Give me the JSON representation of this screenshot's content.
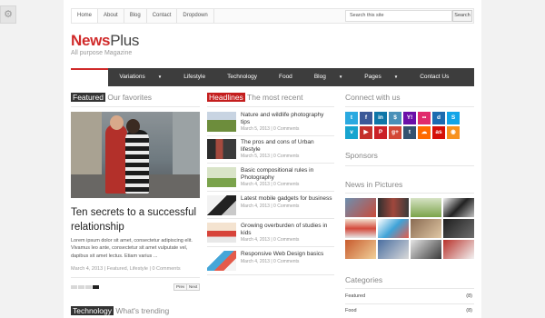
{
  "topbar": {
    "links": [
      "Home",
      "About",
      "Blog",
      "Contact",
      "Dropdown"
    ],
    "search_placeholder": "Search this site",
    "search_button": "Search"
  },
  "site": {
    "title_part1": "News",
    "title_part2": "Plus",
    "tagline": "All purpose Magazine"
  },
  "nav": {
    "items": [
      "Home",
      "Variations",
      "Lifestyle",
      "Technology",
      "Food",
      "Blog",
      "Pages",
      "Contact Us"
    ],
    "active": "Home"
  },
  "featured": {
    "label": "Featured",
    "subtitle": "Our favorites",
    "title": "Ten secrets to a successful relationship",
    "excerpt": "Lorem ipsum dolor sit amet, consectetur adipiscing elit. Vivamus leo ante, consectetur sit amet vulputate vel, dapibus sit amet lectus. Etiam varius ...",
    "meta": {
      "date": "March 4, 2013",
      "cat1": "Featured",
      "cat2": "Lifestyle",
      "comments": "0 Comments"
    },
    "prev": "Prev",
    "next": "Next"
  },
  "headlines": {
    "label": "Headlines",
    "subtitle": "The most recent",
    "items": [
      {
        "title": "Nature and wildlife photography tips",
        "date": "March 5, 2013",
        "comments": "0 Comments"
      },
      {
        "title": "The pros and cons of Urban lifestyle",
        "date": "March 5, 2013",
        "comments": "0 Comments"
      },
      {
        "title": "Basic compositional rules in Photography",
        "date": "March 4, 2013",
        "comments": "0 Comments"
      },
      {
        "title": "Latest mobile gadgets for business",
        "date": "March 4, 2013",
        "comments": "0 Comments"
      },
      {
        "title": "Growing overburden of studies in kids",
        "date": "March 4, 2013",
        "comments": "0 Comments"
      },
      {
        "title": "Responsive Web Design basics",
        "date": "March 4, 2013",
        "comments": "0 Comments"
      }
    ]
  },
  "technology": {
    "label": "Technology",
    "subtitle": "What's trending"
  },
  "sidebar": {
    "connect_title": "Connect with us",
    "socials": [
      {
        "name": "twitter-icon",
        "glyph": "t",
        "color": "#2aa9e0"
      },
      {
        "name": "facebook-icon",
        "glyph": "f",
        "color": "#3b5998"
      },
      {
        "name": "linkedin-icon",
        "glyph": "in",
        "color": "#0e76a8"
      },
      {
        "name": "dollar-icon",
        "glyph": "$",
        "color": "#4a90b8"
      },
      {
        "name": "yahoo-icon",
        "glyph": "Y!",
        "color": "#6b0fa8"
      },
      {
        "name": "flickr-icon",
        "glyph": "••",
        "color": "#e02a6c"
      },
      {
        "name": "digg-icon",
        "glyph": "d",
        "color": "#1d6bb0"
      },
      {
        "name": "skype-icon",
        "glyph": "S",
        "color": "#12a5e8"
      },
      {
        "name": "vimeo-icon",
        "glyph": "v",
        "color": "#17a4cf"
      },
      {
        "name": "youtube-icon",
        "glyph": "▶",
        "color": "#c4302b"
      },
      {
        "name": "pinterest-icon",
        "glyph": "P",
        "color": "#cb2027"
      },
      {
        "name": "googleplus-icon",
        "glyph": "g+",
        "color": "#d34836"
      },
      {
        "name": "tumblr-icon",
        "glyph": "t",
        "color": "#34526f"
      },
      {
        "name": "soundcloud-icon",
        "glyph": "☁",
        "color": "#ff6a00"
      },
      {
        "name": "lastfm-icon",
        "glyph": "as",
        "color": "#d51007"
      },
      {
        "name": "rss-icon",
        "glyph": "◉",
        "color": "#f7921e"
      }
    ],
    "sponsors_title": "Sponsors",
    "nip_title": "News in Pictures",
    "categories_title": "Categories",
    "categories": [
      {
        "name": "Featured",
        "count": "(8)"
      },
      {
        "name": "Food",
        "count": "(8)"
      }
    ]
  }
}
